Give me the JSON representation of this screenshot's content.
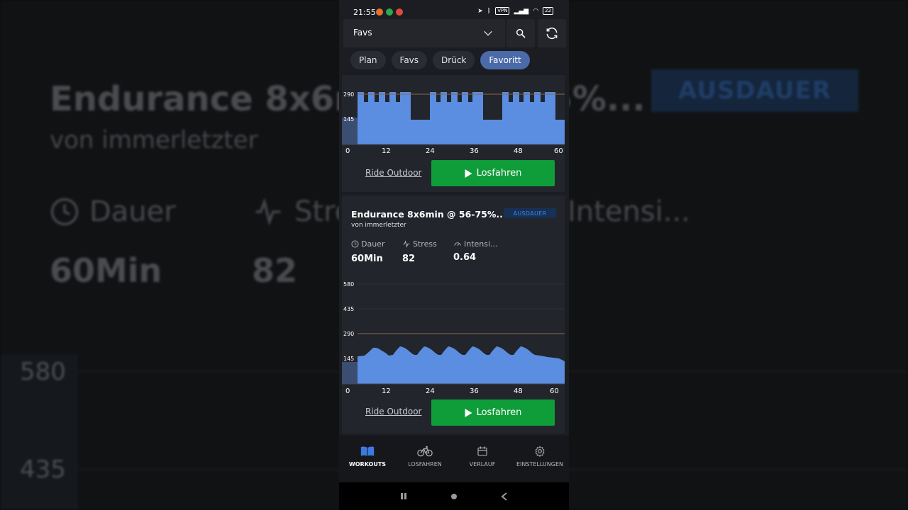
{
  "status": {
    "time": "21:55",
    "vpn": "VPN",
    "battery": "22"
  },
  "header": {
    "selector_value": "Favs"
  },
  "tabs": [
    {
      "label": "Plan",
      "active": false
    },
    {
      "label": "Favs",
      "active": false
    },
    {
      "label": "Drück",
      "active": false
    },
    {
      "label": "Favoritt",
      "active": true
    }
  ],
  "card1": {
    "ride_outdoor": "Ride Outdoor",
    "start": "Losfahren",
    "chart": {
      "y_labels": [
        "290",
        "145"
      ],
      "x_labels": [
        "0",
        "12",
        "24",
        "36",
        "48",
        "60"
      ]
    }
  },
  "card2": {
    "title": "Endurance 8x6min @ 56-75%...",
    "author": "von immerletzter",
    "badge": "AUSDAUER",
    "stats": {
      "duration_label": "Dauer",
      "duration_value": "60Min",
      "stress_label": "Stress",
      "stress_value": "82",
      "intensity_label": "Intensi...",
      "intensity_value": "0.64"
    },
    "ride_outdoor": "Ride Outdoor",
    "start": "Losfahren",
    "chart": {
      "y_labels": [
        "580",
        "435",
        "290",
        "145"
      ],
      "x_labels": [
        "0",
        "12",
        "24",
        "36",
        "48",
        "60"
      ]
    }
  },
  "nav": [
    {
      "label": "WORKOUTS",
      "icon": "book-icon",
      "active": true
    },
    {
      "label": "LOSFAHREN",
      "icon": "bike-icon",
      "active": false
    },
    {
      "label": "VERLAUF",
      "icon": "calendar-icon",
      "active": false
    },
    {
      "label": "EINSTELLUNGEN",
      "icon": "gear-icon",
      "active": false
    }
  ],
  "colors": {
    "accent": "#4a6aa8",
    "go_button": "#0f9d3a",
    "chart_fill": "#5b8de0",
    "ftp_line": "#8a6a4a",
    "badge_text": "#3d86e0"
  }
}
